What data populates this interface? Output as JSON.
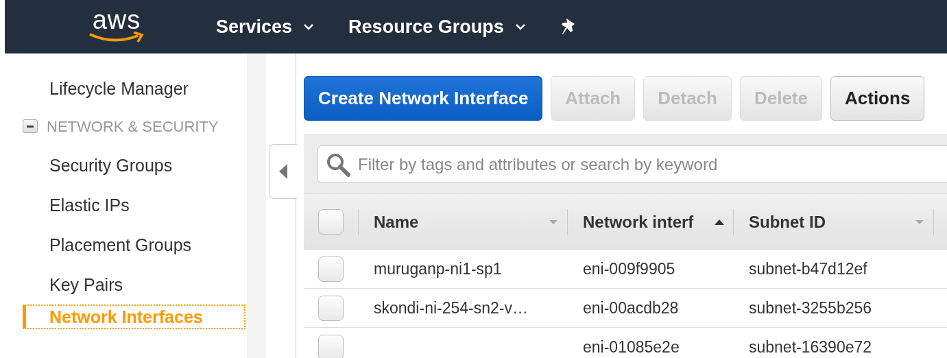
{
  "top_nav": {
    "logo_text": "aws",
    "items": [
      {
        "label": "Services",
        "kind": "menu"
      },
      {
        "label": "Resource Groups",
        "kind": "menu"
      },
      {
        "kind": "pin"
      }
    ]
  },
  "sidebar": {
    "items": [
      {
        "kind": "link",
        "label": "Lifecycle Manager",
        "selected": false
      },
      {
        "kind": "group",
        "label": "NETWORK & SECURITY",
        "expanded": true
      },
      {
        "kind": "link",
        "label": "Security Groups",
        "selected": false
      },
      {
        "kind": "link",
        "label": "Elastic IPs",
        "selected": false
      },
      {
        "kind": "link",
        "label": "Placement Groups",
        "selected": false
      },
      {
        "kind": "link",
        "label": "Key Pairs",
        "selected": false
      },
      {
        "kind": "link",
        "label": "Network Interfaces",
        "selected": true
      }
    ]
  },
  "toolbar": {
    "buttons": [
      {
        "label": "Create Network Interface",
        "kind": "primary",
        "disabled": false
      },
      {
        "label": "Attach",
        "kind": "default",
        "disabled": true
      },
      {
        "label": "Detach",
        "kind": "default",
        "disabled": true
      },
      {
        "label": "Delete",
        "kind": "default",
        "disabled": true
      },
      {
        "label": "Actions",
        "kind": "default",
        "disabled": false
      }
    ]
  },
  "search": {
    "placeholder": "Filter by tags and attributes or search by keyword"
  },
  "table": {
    "select_all": {
      "checked": false
    },
    "columns": [
      {
        "label": "Name",
        "sorted": false
      },
      {
        "label": "Network interf",
        "sorted": true
      },
      {
        "label": "Subnet ID",
        "sorted": false
      }
    ],
    "rows": [
      {
        "selected": false,
        "cells": [
          "muruganp-ni1-sp1",
          "eni-009f9905",
          "subnet-b47d12ef"
        ]
      },
      {
        "selected": false,
        "cells": [
          "skondi-ni-254-sn2-v…",
          "eni-00acdb28",
          "subnet-3255b256"
        ]
      },
      {
        "selected": false,
        "cells": [
          "",
          "eni-01085e2e",
          "subnet-16390e72"
        ]
      }
    ]
  }
}
